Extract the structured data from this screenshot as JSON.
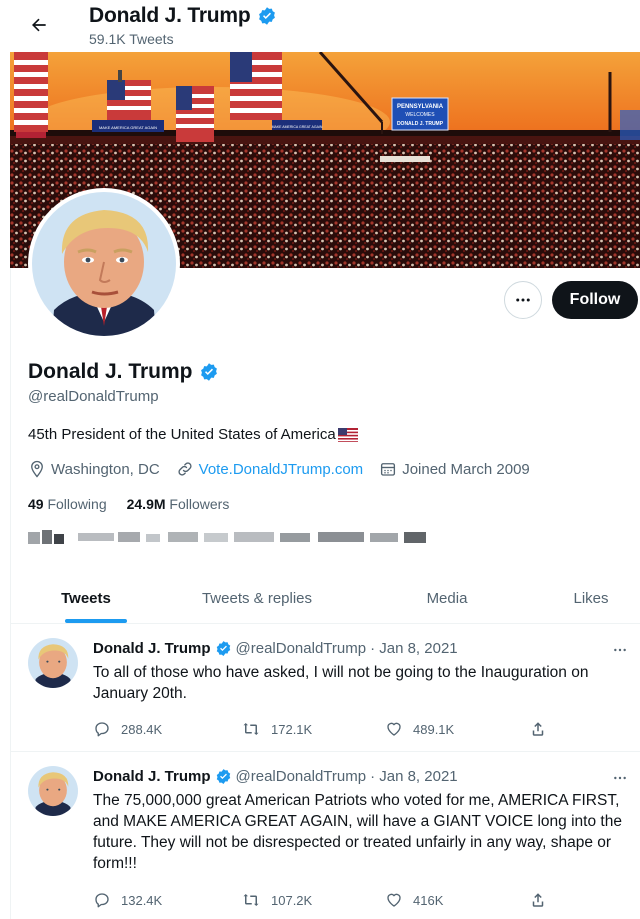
{
  "header": {
    "name": "Donald J. Trump",
    "tweet_count": "59.1K Tweets"
  },
  "banner": {
    "signs": [
      "PENNSYLVANIA",
      "WELCOMES",
      "DONALD J. TRUMP",
      "MAKE AMERICA GREAT AGAIN"
    ]
  },
  "profile": {
    "name": "Donald J. Trump",
    "handle": "@realDonaldTrump",
    "bio": "45th President of the United States of America",
    "bio_emoji": "flag-us-icon",
    "location": "Washington, DC",
    "website": "Vote.DonaldJTrump.com",
    "joined": "Joined March 2009",
    "following_count": "49",
    "following_label": "Following",
    "followers_count": "24.9M",
    "followers_label": "Followers",
    "follow_button": "Follow"
  },
  "tabs": [
    {
      "label": "Tweets",
      "active": true
    },
    {
      "label": "Tweets & replies",
      "active": false
    },
    {
      "label": "Media",
      "active": false
    },
    {
      "label": "Likes",
      "active": false
    }
  ],
  "tweets": [
    {
      "name": "Donald J. Trump",
      "handle": "@realDonaldTrump",
      "date": "· Jan 8, 2021",
      "text": "To all of those who have asked, I will not be going to the Inauguration on January 20th.",
      "replies": "288.4K",
      "retweets": "172.1K",
      "likes": "489.1K"
    },
    {
      "name": "Donald J. Trump",
      "handle": "@realDonaldTrump",
      "date": "· Jan 8, 2021",
      "text": "The 75,000,000 great American Patriots who voted for me, AMERICA FIRST, and MAKE AMERICA GREAT AGAIN, will have a GIANT VOICE long into the future. They will not be disrespected or treated unfairly in any way, shape or form!!!",
      "replies": "132.4K",
      "retweets": "107.2K",
      "likes": "416K"
    }
  ],
  "colors": {
    "accent": "#1d9bf0",
    "text": "#0f1419",
    "secondary": "#536471",
    "follow_bg": "#0f1419"
  }
}
